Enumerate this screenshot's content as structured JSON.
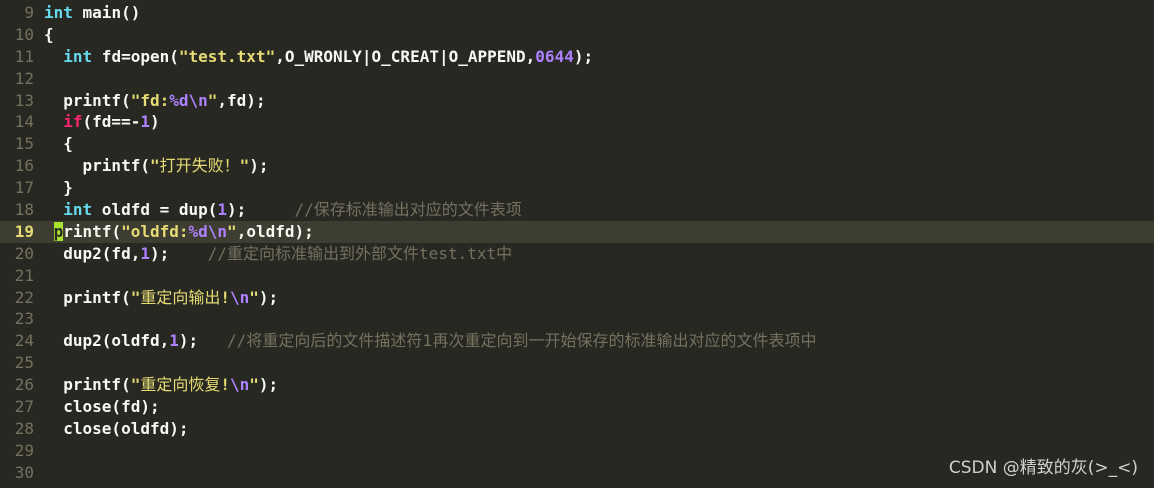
{
  "editor": {
    "current_line": "19",
    "lines": [
      {
        "num": "9",
        "tokens": [
          {
            "c": "t-type",
            "t": "int"
          },
          {
            "c": "t-plain",
            "t": " main()"
          }
        ]
      },
      {
        "num": "10",
        "tokens": [
          {
            "c": "t-plain",
            "t": "{"
          }
        ]
      },
      {
        "num": "11",
        "tokens": [
          {
            "c": "t-plain",
            "t": "  "
          },
          {
            "c": "t-type",
            "t": "int"
          },
          {
            "c": "t-plain",
            "t": " fd=open("
          },
          {
            "c": "t-str",
            "t": "\"test.txt\""
          },
          {
            "c": "t-plain",
            "t": ",O_WRONLY|O_CREAT|O_APPEND,"
          },
          {
            "c": "t-num",
            "t": "0644"
          },
          {
            "c": "t-plain",
            "t": ");"
          }
        ]
      },
      {
        "num": "12",
        "tokens": []
      },
      {
        "num": "13",
        "tokens": [
          {
            "c": "t-plain",
            "t": "  printf("
          },
          {
            "c": "t-str",
            "t": "\"fd:"
          },
          {
            "c": "t-esc",
            "t": "%d\\n"
          },
          {
            "c": "t-str",
            "t": "\""
          },
          {
            "c": "t-plain",
            "t": ",fd);"
          }
        ]
      },
      {
        "num": "14",
        "tokens": [
          {
            "c": "t-plain",
            "t": "  "
          },
          {
            "c": "t-kw",
            "t": "if"
          },
          {
            "c": "t-plain",
            "t": "(fd==-"
          },
          {
            "c": "t-num",
            "t": "1"
          },
          {
            "c": "t-plain",
            "t": ")"
          }
        ]
      },
      {
        "num": "15",
        "tokens": [
          {
            "c": "t-plain",
            "t": "  {"
          }
        ]
      },
      {
        "num": "16",
        "tokens": [
          {
            "c": "t-plain",
            "t": "    printf("
          },
          {
            "c": "t-str",
            "t": "\""
          },
          {
            "c": "t-str t-cjk",
            "t": "打开失败！"
          },
          {
            "c": "t-str",
            "t": "\""
          },
          {
            "c": "t-plain",
            "t": ");"
          }
        ]
      },
      {
        "num": "17",
        "tokens": [
          {
            "c": "t-plain",
            "t": "  }"
          }
        ]
      },
      {
        "num": "18",
        "tokens": [
          {
            "c": "t-plain",
            "t": "  "
          },
          {
            "c": "t-type",
            "t": "int"
          },
          {
            "c": "t-plain",
            "t": " oldfd = dup("
          },
          {
            "c": "t-num",
            "t": "1"
          },
          {
            "c": "t-plain",
            "t": ");     "
          },
          {
            "c": "t-com",
            "t": "//"
          },
          {
            "c": "t-com t-cjk",
            "t": "保存标准输出对应的文件表项"
          }
        ]
      },
      {
        "num": "19",
        "tokens": [
          {
            "c": "t-plain",
            "t": " "
          },
          {
            "c": "cursor",
            "t": "p"
          },
          {
            "c": "t-plain",
            "t": "rintf("
          },
          {
            "c": "t-str",
            "t": "\"oldfd:"
          },
          {
            "c": "t-esc",
            "t": "%d\\n"
          },
          {
            "c": "t-str",
            "t": "\""
          },
          {
            "c": "t-plain",
            "t": ",oldfd);"
          }
        ]
      },
      {
        "num": "20",
        "tokens": [
          {
            "c": "t-plain",
            "t": "  dup2(fd,"
          },
          {
            "c": "t-num",
            "t": "1"
          },
          {
            "c": "t-plain",
            "t": ");    "
          },
          {
            "c": "t-com",
            "t": "//"
          },
          {
            "c": "t-com t-cjk",
            "t": "重定向标准输出到外部文件"
          },
          {
            "c": "t-com",
            "t": "test.txt"
          },
          {
            "c": "t-com t-cjk",
            "t": "中"
          }
        ]
      },
      {
        "num": "21",
        "tokens": []
      },
      {
        "num": "22",
        "tokens": [
          {
            "c": "t-plain",
            "t": "  printf("
          },
          {
            "c": "t-str",
            "t": "\""
          },
          {
            "c": "t-str t-cjk",
            "t": "重定向输出"
          },
          {
            "c": "t-str",
            "t": "!"
          },
          {
            "c": "t-esc",
            "t": "\\n"
          },
          {
            "c": "t-str",
            "t": "\""
          },
          {
            "c": "t-plain",
            "t": ");"
          }
        ]
      },
      {
        "num": "23",
        "tokens": []
      },
      {
        "num": "24",
        "tokens": [
          {
            "c": "t-plain",
            "t": "  dup2(oldfd,"
          },
          {
            "c": "t-num",
            "t": "1"
          },
          {
            "c": "t-plain",
            "t": ");   "
          },
          {
            "c": "t-com",
            "t": "//"
          },
          {
            "c": "t-com t-cjk",
            "t": "将重定向后的文件描述符1再次重定向到一开始保存的标准输出对应的文件表项中"
          }
        ]
      },
      {
        "num": "25",
        "tokens": []
      },
      {
        "num": "26",
        "tokens": [
          {
            "c": "t-plain",
            "t": "  printf("
          },
          {
            "c": "t-str",
            "t": "\""
          },
          {
            "c": "t-str t-cjk",
            "t": "重定向恢复"
          },
          {
            "c": "t-str",
            "t": "!"
          },
          {
            "c": "t-esc",
            "t": "\\n"
          },
          {
            "c": "t-str",
            "t": "\""
          },
          {
            "c": "t-plain",
            "t": ");"
          }
        ]
      },
      {
        "num": "27",
        "tokens": [
          {
            "c": "t-plain",
            "t": "  close(fd);"
          }
        ]
      },
      {
        "num": "28",
        "tokens": [
          {
            "c": "t-plain",
            "t": "  close(oldfd);"
          }
        ]
      },
      {
        "num": "29",
        "tokens": []
      },
      {
        "num": "30",
        "tokens": []
      }
    ]
  },
  "watermark": "CSDN @精致的灰(>_<)",
  "colors": {
    "background": "#272822",
    "line_number": "#75715e",
    "type": "#66d9ef",
    "string": "#e6db74",
    "escape_and_number": "#ae81ff",
    "keyword": "#f92672",
    "comment": "#75715e",
    "cursor": "#a6e22e"
  }
}
